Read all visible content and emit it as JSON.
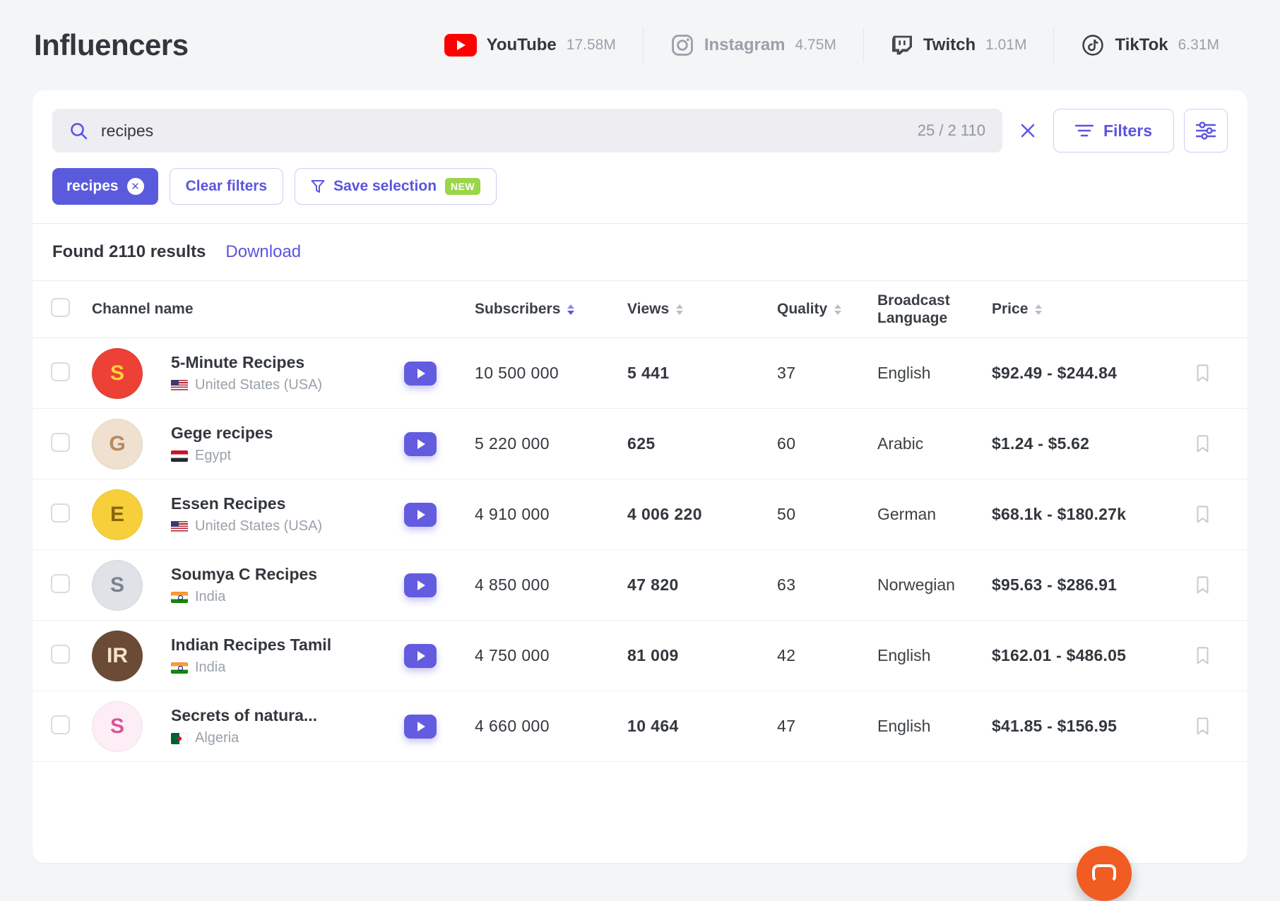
{
  "page": {
    "title": "Influencers"
  },
  "colors": {
    "accent": "#5b54e0",
    "chip_bg": "#5a5bdc",
    "text_dark": "#33373d",
    "text_gray": "#9aa1aa",
    "border": "#e9ebef",
    "yt_red": "#ff0000",
    "badge_green": "#9bd54a",
    "chat_orange": "#f05c22"
  },
  "icons": {
    "search": "magnifier-icon",
    "clear": "x-icon",
    "filters": "filter-lines-icon",
    "settings": "sliders-icon",
    "save": "funnel-icon",
    "bookmark": "bookmark-outline-icon",
    "play": "youtube-play-icon",
    "chat": "chat-bubble-icon"
  },
  "platforms": [
    {
      "id": "youtube",
      "name": "YouTube",
      "count": "17.58M",
      "active": true
    },
    {
      "id": "instagram",
      "name": "Instagram",
      "count": "4.75M",
      "active": false
    },
    {
      "id": "twitch",
      "name": "Twitch",
      "count": "1.01M",
      "active": false
    },
    {
      "id": "tiktok",
      "name": "TikTok",
      "count": "6.31M",
      "active": false
    }
  ],
  "search": {
    "value": "recipes",
    "counter": "25 / 2 110",
    "filters_label": "Filters"
  },
  "chips": {
    "active_filter": "recipes",
    "clear_label": "Clear filters",
    "save_label": "Save selection",
    "save_badge": "NEW"
  },
  "results": {
    "summary": "Found 2110 results",
    "download_label": "Download"
  },
  "table": {
    "headers": {
      "channel": "Channel name",
      "subscribers": "Subscribers",
      "views": "Views",
      "quality": "Quality",
      "language": "Broadcast Language",
      "price": "Price"
    },
    "rows": [
      {
        "name": "5-Minute Recipes",
        "country": "United States (USA)",
        "flag": "us",
        "avatar": {
          "bg": "#ee4136",
          "fg": "#ffd23f",
          "label": "S"
        },
        "subscribers": "10 500 000",
        "views": "5 441",
        "quality": "37",
        "language": "English",
        "price": "$92.49 - $244.84"
      },
      {
        "name": "Gege recipes",
        "country": "Egypt",
        "flag": "eg",
        "avatar": {
          "bg": "#efe0cf",
          "fg": "#b58a5f",
          "label": "G"
        },
        "subscribers": "5 220 000",
        "views": "625",
        "quality": "60",
        "language": "Arabic",
        "price": "$1.24 - $5.62"
      },
      {
        "name": "Essen Recipes",
        "country": "United States (USA)",
        "flag": "us",
        "avatar": {
          "bg": "#f6cf3a",
          "fg": "#8a6410",
          "label": "E"
        },
        "subscribers": "4 910 000",
        "views": "4 006 220",
        "quality": "50",
        "language": "German",
        "price": "$68.1k - $180.27k"
      },
      {
        "name": "Soumya C Recipes",
        "country": "India",
        "flag": "in",
        "avatar": {
          "bg": "#dfe3e8",
          "fg": "#7b828c",
          "label": "S"
        },
        "subscribers": "4 850 000",
        "views": "47 820",
        "quality": "63",
        "language": "Norwegian",
        "price": "$95.63 - $286.91"
      },
      {
        "name": "Indian Recipes Tamil",
        "country": "India",
        "flag": "in",
        "avatar": {
          "bg": "#6b4a36",
          "fg": "#f3e3c8",
          "label": "IR"
        },
        "subscribers": "4 750 000",
        "views": "81 009",
        "quality": "42",
        "language": "English",
        "price": "$162.01 - $486.05"
      },
      {
        "name": "Secrets of natura...",
        "country": "Algeria",
        "flag": "dz",
        "avatar": {
          "bg": "#fdeef5",
          "fg": "#d6569b",
          "label": "S"
        },
        "subscribers": "4 660 000",
        "views": "10 464",
        "quality": "47",
        "language": "English",
        "price": "$41.85 - $156.95"
      }
    ]
  }
}
